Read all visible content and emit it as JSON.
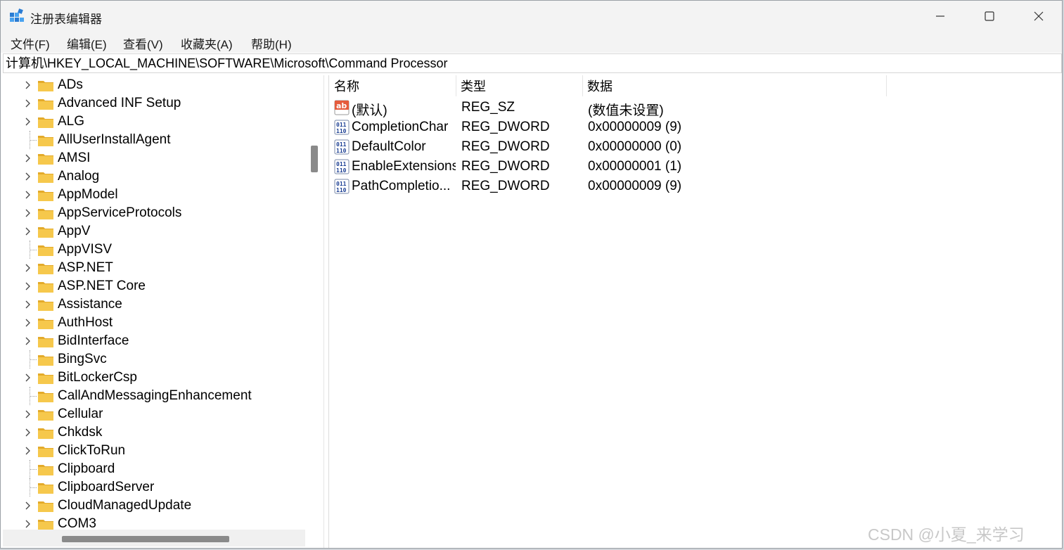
{
  "window": {
    "title": "注册表编辑器",
    "controls": {
      "minimize": "minimize-icon",
      "maximize": "maximize-icon",
      "close": "close-icon"
    }
  },
  "menu": [
    {
      "label": "文件(F)"
    },
    {
      "label": "编辑(E)"
    },
    {
      "label": "查看(V)"
    },
    {
      "label": "收藏夹(A)"
    },
    {
      "label": "帮助(H)"
    }
  ],
  "address": {
    "path": "计算机\\HKEY_LOCAL_MACHINE\\SOFTWARE\\Microsoft\\Command Processor"
  },
  "tree": [
    {
      "label": "ADs",
      "expandable": true
    },
    {
      "label": "Advanced INF Setup",
      "expandable": true
    },
    {
      "label": "ALG",
      "expandable": true
    },
    {
      "label": "AllUserInstallAgent",
      "expandable": false
    },
    {
      "label": "AMSI",
      "expandable": true
    },
    {
      "label": "Analog",
      "expandable": true
    },
    {
      "label": "AppModel",
      "expandable": true
    },
    {
      "label": "AppServiceProtocols",
      "expandable": true
    },
    {
      "label": "AppV",
      "expandable": true
    },
    {
      "label": "AppVISV",
      "expandable": false
    },
    {
      "label": "ASP.NET",
      "expandable": true
    },
    {
      "label": "ASP.NET Core",
      "expandable": true
    },
    {
      "label": "Assistance",
      "expandable": true
    },
    {
      "label": "AuthHost",
      "expandable": true
    },
    {
      "label": "BidInterface",
      "expandable": true
    },
    {
      "label": "BingSvc",
      "expandable": false
    },
    {
      "label": "BitLockerCsp",
      "expandable": true
    },
    {
      "label": "CallAndMessagingEnhancement",
      "expandable": false
    },
    {
      "label": "Cellular",
      "expandable": true
    },
    {
      "label": "Chkdsk",
      "expandable": true
    },
    {
      "label": "ClickToRun",
      "expandable": true
    },
    {
      "label": "Clipboard",
      "expandable": false
    },
    {
      "label": "ClipboardServer",
      "expandable": false
    },
    {
      "label": "CloudManagedUpdate",
      "expandable": true
    },
    {
      "label": "COM3",
      "expandable": true
    }
  ],
  "columns": {
    "name": "名称",
    "type": "类型",
    "data": "数据"
  },
  "values": [
    {
      "name": "(默认)",
      "type": "REG_SZ",
      "data": "(数值未设置)",
      "icon": "string-value-icon"
    },
    {
      "name": "CompletionChar",
      "type": "REG_DWORD",
      "data": "0x00000009 (9)",
      "icon": "binary-value-icon"
    },
    {
      "name": "DefaultColor",
      "type": "REG_DWORD",
      "data": "0x00000000 (0)",
      "icon": "binary-value-icon"
    },
    {
      "name": "EnableExtensions",
      "type": "REG_DWORD",
      "data": "0x00000001 (1)",
      "icon": "binary-value-icon"
    },
    {
      "name": "PathCompletio...",
      "type": "REG_DWORD",
      "data": "0x00000009 (9)",
      "icon": "binary-value-icon"
    }
  ],
  "watermark": "CSDN @小夏_来学习",
  "colors": {
    "folder": "#f6c84c",
    "folder_dark": "#e3aa2a",
    "accent": "#0a64c8"
  }
}
